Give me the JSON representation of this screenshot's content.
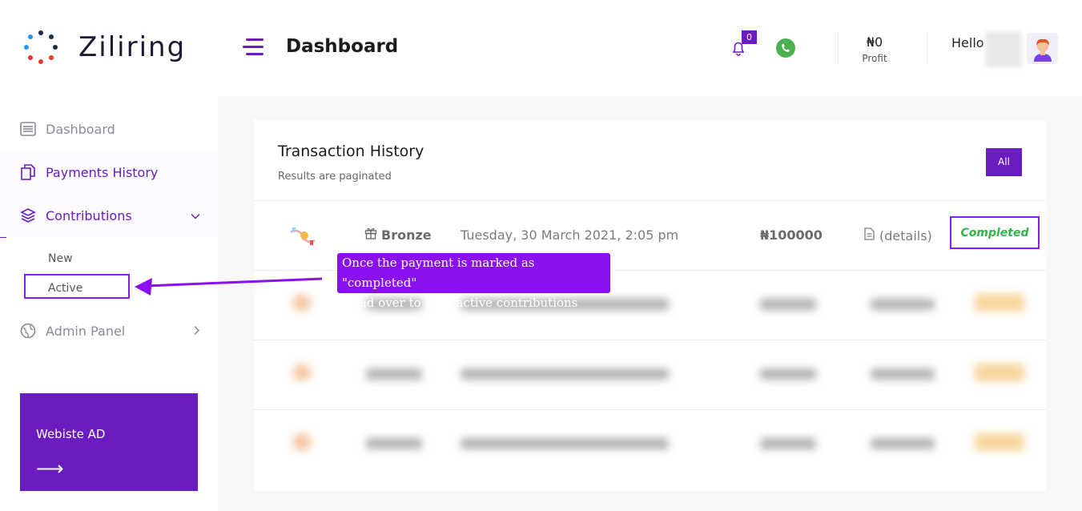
{
  "brand": {
    "name": "Ziliring"
  },
  "sidebar": {
    "items": [
      {
        "label": "Dashboard",
        "icon": "dashboard-icon"
      },
      {
        "label": "Payments History",
        "icon": "documents-icon"
      },
      {
        "label": "Contributions",
        "icon": "layers-icon"
      },
      {
        "label": "Admin Panel",
        "icon": "globe-icon"
      }
    ],
    "sub_items": [
      {
        "label": "New"
      },
      {
        "label": "Active"
      }
    ],
    "ad": {
      "title": "Webiste AD",
      "arrow": "⟶"
    }
  },
  "header": {
    "title": "Dashboard",
    "notifications_count": "0",
    "profit_value": "₦0",
    "profit_label": "Profit",
    "greeting": "Hello"
  },
  "transactions": {
    "title": "Transaction History",
    "subtitle": "Results are paginated",
    "filter_button": "All",
    "rows": [
      {
        "tier": "Bronze",
        "date": "Tuesday, 30 March 2021, 2:05 pm",
        "amount": "₦100000",
        "details": "(details)",
        "status": "Completed"
      }
    ]
  },
  "tooltip": {
    "line1": "Once the payment is marked as \"completed\"",
    "line2": "Head over to your active contributions"
  },
  "colors": {
    "accent": "#6a1cc0",
    "highlight": "#8a1cf0",
    "success": "#35b34a"
  }
}
